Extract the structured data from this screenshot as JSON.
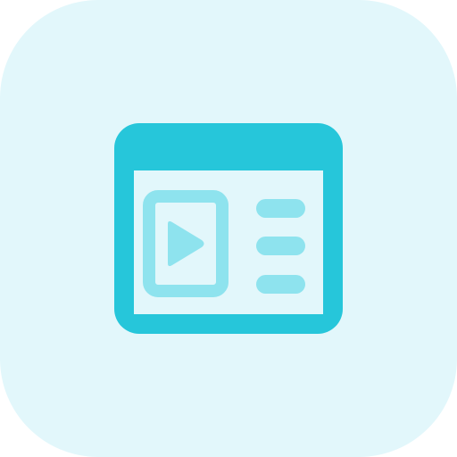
{
  "app_icon": {
    "icon_name": "video-player-browser-window-icon",
    "background_color": "#e2f7fb",
    "primary_color": "#26c6da",
    "secondary_color": "#8ee3ee",
    "window_fill_color": "#e2f7fb",
    "text_lines_count": 3
  }
}
